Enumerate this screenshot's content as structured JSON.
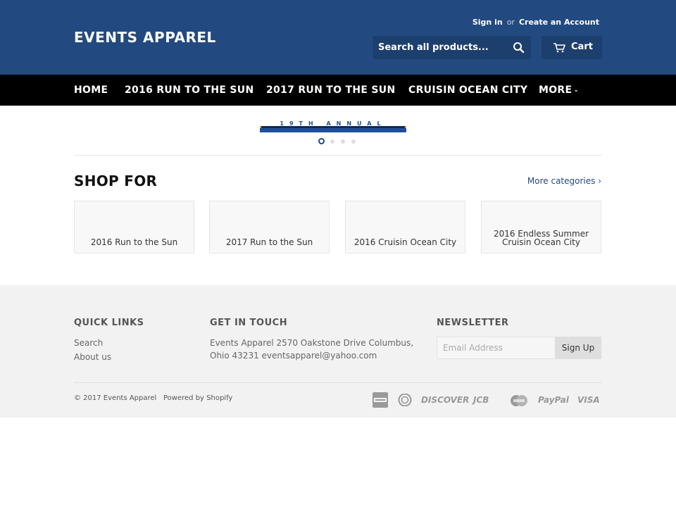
{
  "header": {
    "brand": "EVENTS APPAREL",
    "sign_in": "Sign in",
    "or": "or",
    "create_account": "Create an Account",
    "search_placeholder": "Search all products...",
    "cart_label": "Cart"
  },
  "nav": {
    "items": [
      "HOME",
      "2016 RUN TO THE SUN",
      "2017 RUN TO THE SUN",
      "CRUISIN OCEAN CITY",
      "MORE"
    ]
  },
  "slider": {
    "banner_text": "19TH ANNUAL",
    "dot_count": 4,
    "active_index": 0
  },
  "shop": {
    "title": "SHOP FOR",
    "more_link": "More categories ›",
    "categories": [
      "2016 Run to the Sun",
      "2017 Run to the Sun",
      "2016 Cruisin Ocean City",
      "2016 Endless Summer Cruisin Ocean City"
    ]
  },
  "footer": {
    "quick_links_title": "QUICK LINKS",
    "quick_links": [
      "Search",
      "About us"
    ],
    "contact_title": "GET IN TOUCH",
    "contact_text": "Events Apparel 2570 Oakstone Drive Columbus, Ohio 43231 eventsapparel@yahoo.com",
    "newsletter_title": "NEWSLETTER",
    "email_placeholder": "Email Address",
    "signup_label": "Sign Up",
    "copyright": "© 2017 Events Apparel",
    "powered_by": "Powered by Shopify",
    "payments": [
      "american-express-icon",
      "diners-club-icon",
      "DISCOVER",
      "JCB",
      "mastercard-icon",
      "PayPal",
      "VISA"
    ]
  },
  "colors": {
    "header_bg": "#224a80",
    "nav_bg": "#000000",
    "footer_bg": "#f2f2f2",
    "accent": "#224a80"
  }
}
